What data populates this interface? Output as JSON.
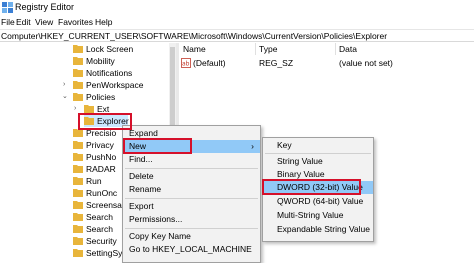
{
  "window": {
    "title": "Registry Editor"
  },
  "menu": [
    "File",
    "Edit",
    "View",
    "Favorites",
    "Help"
  ],
  "address": "Computer\\HKEY_CURRENT_USER\\SOFTWARE\\Microsoft\\Windows\\CurrentVersion\\Policies\\Explorer",
  "tree": {
    "items": [
      "Lock Screen",
      "Mobility",
      "Notifications",
      "PenWorkspace",
      "Policies",
      "Ext",
      "Explorer",
      "Precisio",
      "Privacy",
      "PushNo",
      "RADAR",
      "Run",
      "RunOnc",
      "Screensa",
      "Search",
      "Search",
      "Security",
      "SettingSync"
    ]
  },
  "columns": {
    "name": "Name",
    "type": "Type",
    "data": "Data"
  },
  "values": [
    {
      "name": "(Default)",
      "type": "REG_SZ",
      "data": "(value not set)"
    }
  ],
  "context_menu": {
    "items": [
      "Expand",
      "New",
      "Find...",
      "Delete",
      "Rename",
      "Export",
      "Permissions...",
      "Copy Key Name",
      "Go to HKEY_LOCAL_MACHINE"
    ],
    "submenu_arrow": "›"
  },
  "new_submenu": {
    "items": [
      "Key",
      "String Value",
      "Binary Value",
      "DWORD (32-bit) Value",
      "QWORD (64-bit) Value",
      "Multi-String Value",
      "Expandable String Value"
    ]
  },
  "colors": {
    "highlight": "#91c9f7",
    "annotation": "#d5102a",
    "folder": "#e8b53b"
  },
  "icons": [
    "registry-editor-icon",
    "folder-icon",
    "chevron-right-icon",
    "chevron-down-icon",
    "string-value-icon"
  ]
}
